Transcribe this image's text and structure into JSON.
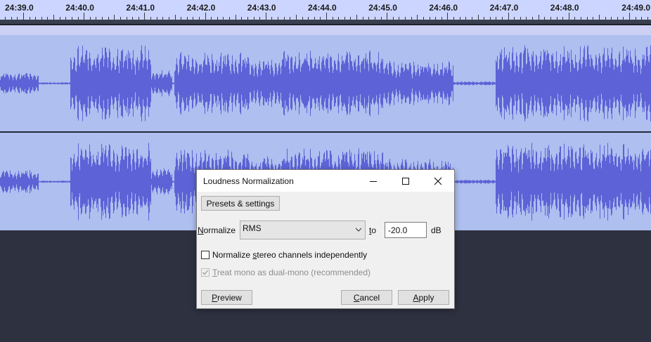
{
  "timeline": {
    "ticks": [
      "24:39.0",
      "24:40.0",
      "24:41.0",
      "24:42.0",
      "24:43.0",
      "24:44.0",
      "24:45.0",
      "24:46.0",
      "24:47.0",
      "24:48.0",
      "24:49.0"
    ]
  },
  "colors": {
    "waveform": "#5d63d6",
    "track_background": "#aebff0",
    "ruler_background": "#ccd5ff",
    "empty_area": "#2e3140"
  },
  "dialog": {
    "title": "Loudness Normalization",
    "minimize_icon": "minimize-icon",
    "maximize_icon": "maximize-icon",
    "close_icon": "close-icon",
    "presets_button": "Presets & settings",
    "normalize_label_u": "N",
    "normalize_label_rest": "ormalize",
    "normalize_value": "RMS",
    "to_label_u": "t",
    "to_label_rest": "o",
    "target_value": "-20.0",
    "unit_label": "dB",
    "stereo_checkbox": {
      "label_a": "Normalize ",
      "label_u": "s",
      "label_b": "tereo channels independently",
      "checked": false
    },
    "mono_checkbox": {
      "label_u": "T",
      "label_rest": "reat mono as dual-mono (recommended)",
      "checked": true,
      "enabled": false
    },
    "preview_button": {
      "u": "P",
      "rest": "review"
    },
    "cancel_button": {
      "u": "C",
      "rest": "ancel"
    },
    "apply_button": {
      "u": "A",
      "rest": "pply"
    }
  }
}
